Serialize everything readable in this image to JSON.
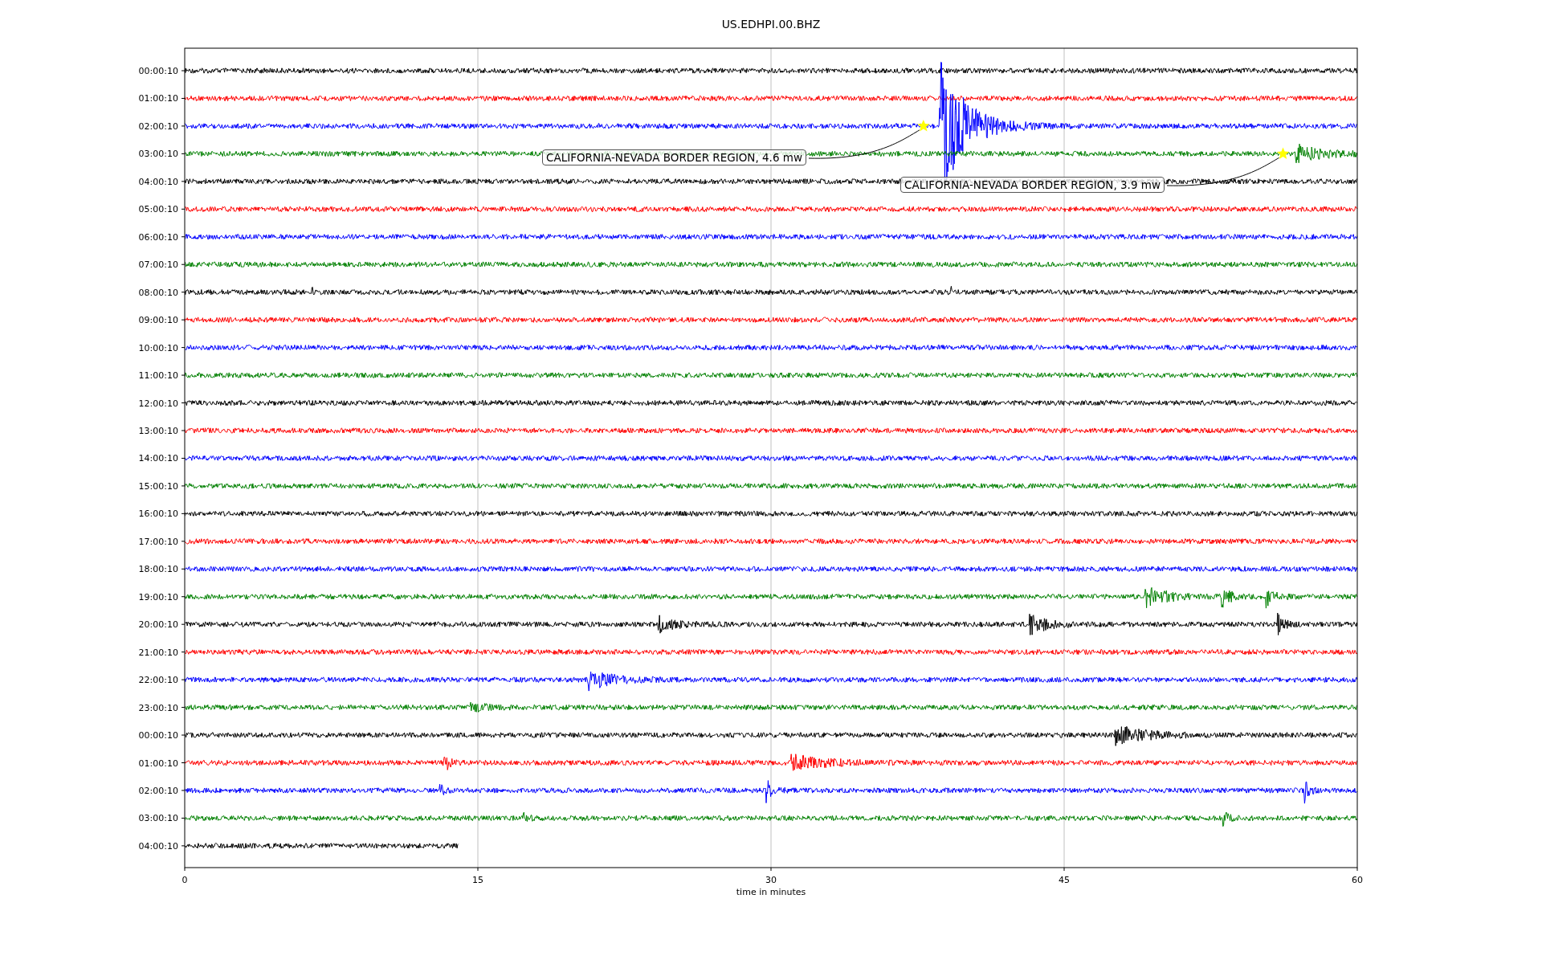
{
  "figure": {
    "title": "US.EDHPI.00.BHZ",
    "xlabel": "time in minutes",
    "xticks": [
      "0",
      "15",
      "30",
      "45",
      "60"
    ],
    "rows": [
      {
        "label": "00:00:10",
        "color": "#000000"
      },
      {
        "label": "01:00:10",
        "color": "#ff0000"
      },
      {
        "label": "02:00:10",
        "color": "#0000ff"
      },
      {
        "label": "03:00:10",
        "color": "#008000"
      },
      {
        "label": "04:00:10",
        "color": "#000000"
      },
      {
        "label": "05:00:10",
        "color": "#ff0000"
      },
      {
        "label": "06:00:10",
        "color": "#0000ff"
      },
      {
        "label": "07:00:10",
        "color": "#008000"
      },
      {
        "label": "08:00:10",
        "color": "#000000"
      },
      {
        "label": "09:00:10",
        "color": "#ff0000"
      },
      {
        "label": "10:00:10",
        "color": "#0000ff"
      },
      {
        "label": "11:00:10",
        "color": "#008000"
      },
      {
        "label": "12:00:10",
        "color": "#000000"
      },
      {
        "label": "13:00:10",
        "color": "#ff0000"
      },
      {
        "label": "14:00:10",
        "color": "#0000ff"
      },
      {
        "label": "15:00:10",
        "color": "#008000"
      },
      {
        "label": "16:00:10",
        "color": "#000000"
      },
      {
        "label": "17:00:10",
        "color": "#ff0000"
      },
      {
        "label": "18:00:10",
        "color": "#0000ff"
      },
      {
        "label": "19:00:10",
        "color": "#008000"
      },
      {
        "label": "20:00:10",
        "color": "#000000"
      },
      {
        "label": "21:00:10",
        "color": "#ff0000"
      },
      {
        "label": "22:00:10",
        "color": "#0000ff"
      },
      {
        "label": "23:00:10",
        "color": "#008000"
      },
      {
        "label": "00:00:10",
        "color": "#000000"
      },
      {
        "label": "01:00:10",
        "color": "#ff0000"
      },
      {
        "label": "02:00:10",
        "color": "#0000ff"
      },
      {
        "label": "03:00:10",
        "color": "#008000"
      },
      {
        "label": "04:00:10",
        "color": "#000000"
      }
    ],
    "annotations": [
      {
        "text": "CALIFORNIA-NEVADA BORDER REGION, 4.6 mw"
      },
      {
        "text": "CALIFORNIA-NEVADA BORDER REGION, 3.9 mw"
      }
    ]
  }
}
